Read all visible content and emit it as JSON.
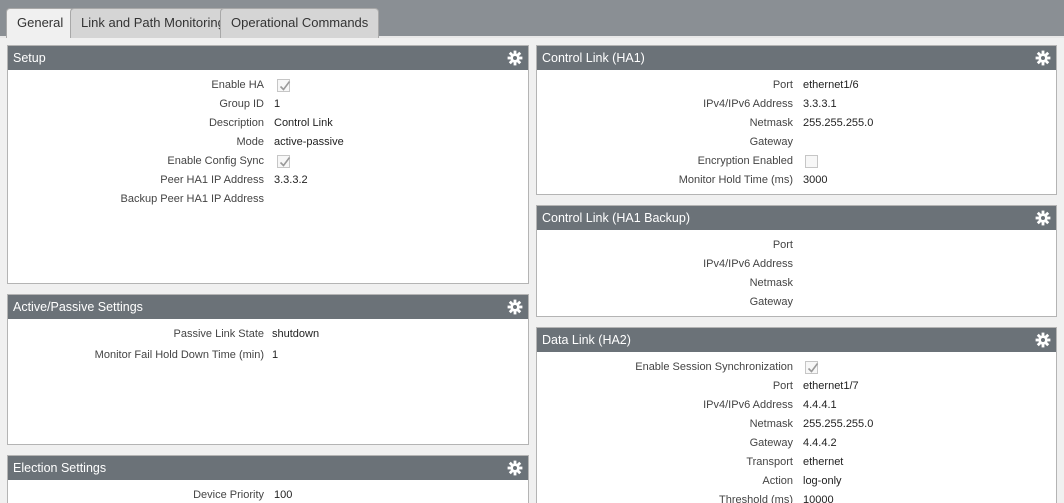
{
  "tabs": [
    {
      "label": "General",
      "active": true
    },
    {
      "label": "Link and Path Monitoring",
      "active": false
    },
    {
      "label": "Operational Commands",
      "active": false
    }
  ],
  "setup": {
    "title": "Setup",
    "enable_ha_label": "Enable HA",
    "enable_ha": true,
    "group_id_label": "Group ID",
    "group_id": "1",
    "description_label": "Description",
    "description": "Control Link",
    "mode_label": "Mode",
    "mode": "active-passive",
    "config_sync_label": "Enable Config Sync",
    "config_sync": true,
    "peer_ip_label": "Peer HA1 IP Address",
    "peer_ip": "3.3.3.2",
    "backup_peer_label": "Backup Peer HA1 IP Address",
    "backup_peer": ""
  },
  "active_passive": {
    "title": "Active/Passive Settings",
    "passive_link_label": "Passive Link State",
    "passive_link": "shutdown",
    "monitor_fail_label": "Monitor Fail Hold Down Time (min)",
    "monitor_fail": "1"
  },
  "election": {
    "title": "Election Settings",
    "priority_label": "Device Priority",
    "priority": "100"
  },
  "ha1": {
    "title": "Control Link (HA1)",
    "port_label": "Port",
    "port": "ethernet1/6",
    "ip_label": "IPv4/IPv6 Address",
    "ip": "3.3.3.1",
    "netmask_label": "Netmask",
    "netmask": "255.255.255.0",
    "gateway_label": "Gateway",
    "gateway": "",
    "encryption_label": "Encryption Enabled",
    "encryption": false,
    "hold_label": "Monitor Hold Time (ms)",
    "hold": "3000"
  },
  "ha1_backup": {
    "title": "Control Link (HA1 Backup)",
    "port_label": "Port",
    "port": "",
    "ip_label": "IPv4/IPv6 Address",
    "ip": "",
    "netmask_label": "Netmask",
    "netmask": "",
    "gateway_label": "Gateway",
    "gateway": ""
  },
  "ha2": {
    "title": "Data Link (HA2)",
    "session_sync_label": "Enable Session Synchronization",
    "session_sync": true,
    "port_label": "Port",
    "port": "ethernet1/7",
    "ip_label": "IPv4/IPv6 Address",
    "ip": "4.4.4.1",
    "netmask_label": "Netmask",
    "netmask": "255.255.255.0",
    "gateway_label": "Gateway",
    "gateway": "4.4.4.2",
    "transport_label": "Transport",
    "transport": "ethernet",
    "action_label": "Action",
    "action": "log-only",
    "threshold_label": "Threshold (ms)",
    "threshold": "10000"
  },
  "icons": {
    "gear": "gear-icon",
    "checkmark": "checkmark-icon"
  },
  "colors": {
    "panel_header": "#6b7278",
    "tabbar": "#8a8f94"
  }
}
